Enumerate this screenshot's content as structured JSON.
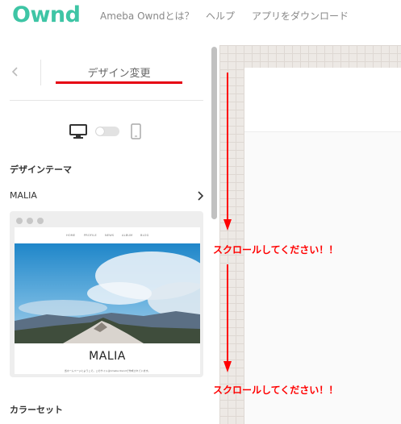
{
  "header": {
    "logo": "Ownd",
    "nav": [
      "Ameba Owndとは？",
      "ヘルプ",
      "アプリをダウンロード"
    ]
  },
  "sidebar": {
    "title": "デザイン変更",
    "design_theme_heading": "デザインテーマ",
    "theme_name": "MALIA",
    "color_set_heading": "カラーセット"
  },
  "preview": {
    "nav_items": [
      "HOME",
      "PROFILE",
      "NEWS",
      "ALBUM",
      "BLOG"
    ],
    "site_name": "MALIA",
    "tagline": "当ホームページにようこそ。このサイトはAmeba Owndで作成されています。"
  },
  "annotations": {
    "scroll_message_1": "スクロールしてください！！",
    "scroll_message_2": "スクロールしてください！！"
  },
  "colors": {
    "brand": "#3ec5a5",
    "accent_red": "#e60012",
    "annotation_red": "#ff0000"
  }
}
